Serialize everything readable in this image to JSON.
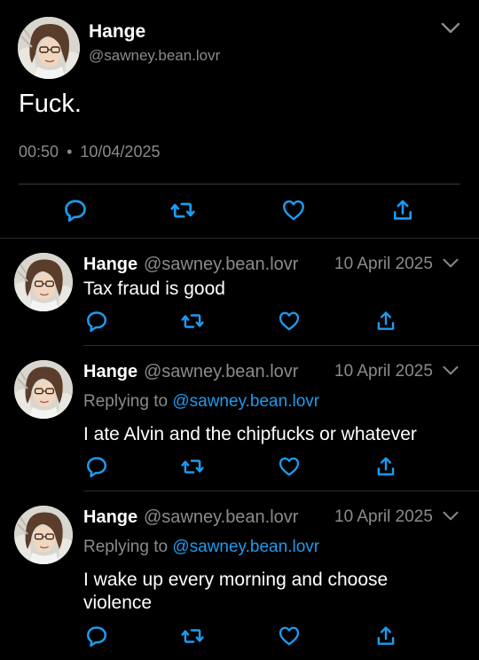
{
  "main_tweet": {
    "display_name": "Hange",
    "handle": "@sawney.bean.lovr",
    "text": "Fuck.",
    "time": "00:50",
    "separator": "•",
    "date": "10/04/2025"
  },
  "replies": [
    {
      "display_name": "Hange",
      "handle": "@sawney.bean.lovr",
      "date": "10 April 2025",
      "text": "Tax fraud is good"
    },
    {
      "display_name": "Hange",
      "handle": "@sawney.bean.lovr",
      "date": "10 April 2025",
      "replying_prefix": "Replying to",
      "replying_to": "@sawney.bean.lovr",
      "text": "I ate Alvin and the chipfucks or whatever"
    },
    {
      "display_name": "Hange",
      "handle": "@sawney.bean.lovr",
      "date": "10 April 2025",
      "replying_prefix": "Replying to",
      "replying_to": "@sawney.bean.lovr",
      "text": "I wake up every morning and choose violence"
    }
  ],
  "icons": {
    "reply": "reply-icon",
    "retweet": "retweet-icon",
    "like": "heart-icon",
    "share": "share-icon",
    "menu": "chevron-down-icon"
  },
  "colors": {
    "background": "#000000",
    "text": "#ffffff",
    "secondary": "#8b8b8b",
    "link": "#1d9bf0"
  }
}
